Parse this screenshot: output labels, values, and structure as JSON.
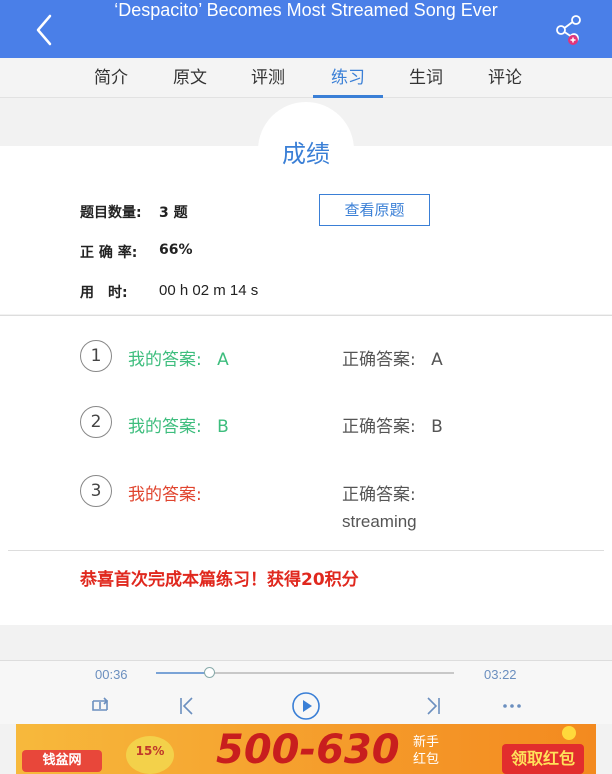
{
  "header": {
    "title": "‘Despacito’ Becomes Most Streamed Song Ever"
  },
  "tabs": [
    {
      "label": "简介"
    },
    {
      "label": "原文"
    },
    {
      "label": "评测"
    },
    {
      "label": "练习"
    },
    {
      "label": "生词"
    },
    {
      "label": "评论"
    }
  ],
  "active_tab": "练习",
  "summary": {
    "title": "成绩",
    "count_label": "题目数量:",
    "count_value": "3 题",
    "accuracy_label": "正 确 率:",
    "accuracy_value": "66%",
    "time_label": "用　时:",
    "time_value": "00 h 02 m 14 s",
    "review_button": "查看原题"
  },
  "answers": [
    {
      "num": "1",
      "mine_label": "我的答案:",
      "mine_value": "A",
      "correct_label": "正确答案:",
      "correct_value": "A",
      "is_correct": true
    },
    {
      "num": "2",
      "mine_label": "我的答案:",
      "mine_value": "B",
      "correct_label": "正确答案:",
      "correct_value": "B",
      "is_correct": true
    },
    {
      "num": "3",
      "mine_label": "我的答案:",
      "mine_value": "",
      "correct_label": "正确答案:",
      "correct_value": "streaming",
      "is_correct": false
    }
  ],
  "congrats": "恭喜首次完成本篇练习！获得20积分",
  "player": {
    "current": "00:36",
    "total": "03:22",
    "progress": 0.18
  },
  "ad": {
    "logo": "钱盆网",
    "pct": "15%",
    "amount": "500-630",
    "newbie_line1": "新手",
    "newbie_line2": "红包",
    "cta": "领取红包"
  },
  "colors": {
    "accent": "#3a7fd6",
    "header": "#4a7fe8",
    "correct": "#3dbd7d",
    "wrong": "#e0442e"
  }
}
